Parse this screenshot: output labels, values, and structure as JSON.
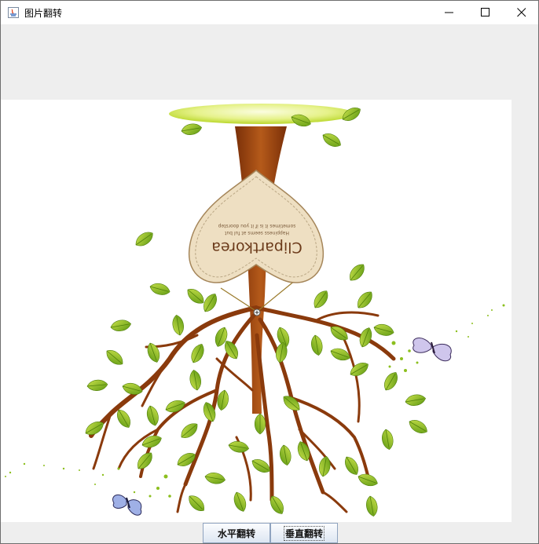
{
  "window": {
    "title": "图片翻转"
  },
  "image": {
    "brand_text": "Clipartkorea",
    "tagline_1": "Happiness seems at ful but",
    "tagline_2": "sometimes it is if it you doorstep"
  },
  "buttons": {
    "horizontal_flip": "水平翻转",
    "vertical_flip": "垂直翻转"
  },
  "colors": {
    "root": "#8a3a0c",
    "leaf": "#8cbf1e",
    "leaf_dark": "#5f8f0f",
    "tag": "#eedfc2",
    "disc": "#d7eb6c"
  }
}
